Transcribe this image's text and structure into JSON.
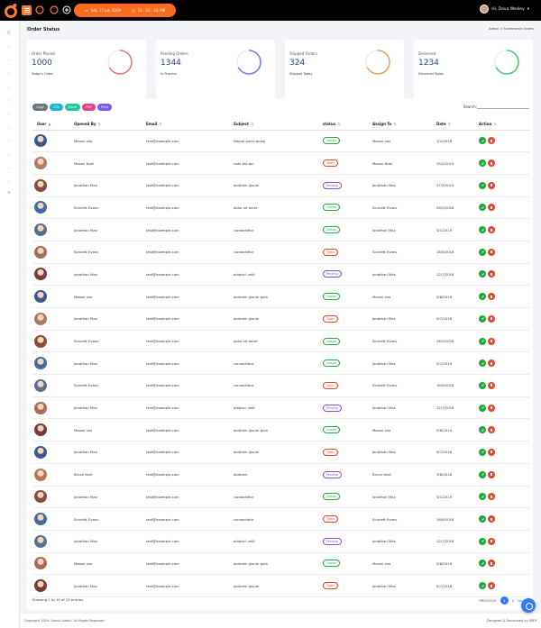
{
  "header": {
    "date": "Sat, 17 jun 2019",
    "time": "10 : 33 : 33 AM",
    "user_name": "Hi, Dova Wesley",
    "brand_color": "#ff6b1f"
  },
  "page": {
    "title": "Order Status",
    "breadcrumb": "Admin > Ecommerce Orders"
  },
  "cards": [
    {
      "label": "Order Placed",
      "value": "1000",
      "sub": "Today's Order",
      "ring_color": "#ef6f6f"
    },
    {
      "label": "Pending Orders",
      "value": "1344",
      "sub": "In Process",
      "ring_color": "#6b7bf0"
    },
    {
      "label": "Shipped Orders",
      "value": "324",
      "sub": "Shipped Today",
      "ring_color": "#f29a55"
    },
    {
      "label": "Delivered",
      "value": "1234",
      "sub": "Delivered Today",
      "ring_color": "#4ec27a"
    }
  ],
  "exports": [
    {
      "label": "Copy",
      "color": "#6c757d"
    },
    {
      "label": "CSV",
      "color": "#17b8d6"
    },
    {
      "label": "Excel",
      "color": "#20c997"
    },
    {
      "label": "PDF",
      "color": "#e83e8c"
    },
    {
      "label": "Print",
      "color": "#7a5af8"
    }
  ],
  "search": {
    "label": "Search:",
    "value": ""
  },
  "table": {
    "headers": [
      "User",
      "Opened By",
      "Email",
      "Subject",
      "status",
      "Assign To",
      "Date",
      "Action"
    ],
    "rows": [
      {
        "opened_by": "Mason vox",
        "email": "test@example.com",
        "subject": "Neque porro quisq",
        "status": "Closed",
        "assign_to": "Mason vox",
        "date": "1/1/2018"
      },
      {
        "opened_by": "Mason Noel",
        "email": "test@example.com",
        "subject": "uam est qui",
        "status": "Open",
        "assign_to": "Mason Noel",
        "date": "15/2/2019"
      },
      {
        "opened_by": "Jonathan Max",
        "email": "test@example.com",
        "subject": "dolorem ipsum",
        "status": "Pending",
        "assign_to": "Jonathan Max",
        "date": "27/3/2019"
      },
      {
        "opened_by": "Scarlett Evans",
        "email": "test@example.com",
        "subject": "dolor sit amet",
        "status": "Closed",
        "assign_to": "Scarlett Evans",
        "date": "26/3/2018"
      },
      {
        "opened_by": "Jonathan Max",
        "email": "test@example.com",
        "subject": "consectetur",
        "status": "Closed",
        "assign_to": "Jonathan Max",
        "date": "5/1/2019"
      },
      {
        "opened_by": "Scarlett Evans",
        "email": "test@example.com",
        "subject": "consectetur",
        "status": "Open",
        "assign_to": "Scarlett Evans",
        "date": "16/9/2018"
      },
      {
        "opened_by": "Jonathan Max",
        "email": "test@example.com",
        "subject": "adipisci velit",
        "status": "Pending",
        "assign_to": "Jonathan Max",
        "date": "12/7/2018"
      },
      {
        "opened_by": "Mason vox",
        "email": "test@example.com",
        "subject": "dolorem ipsum quia",
        "status": "Closed",
        "assign_to": "Mason vox",
        "date": "5/8/2019"
      },
      {
        "opened_by": "Jonathan Max",
        "email": "test@example.com",
        "subject": "dolorem ipsum",
        "status": "Open",
        "assign_to": "Jonathan Max",
        "date": "9/7/2018"
      },
      {
        "opened_by": "Scarlett Evans",
        "email": "test@example.com",
        "subject": "dolor sit amet",
        "status": "Closed",
        "assign_to": "Scarlett Evans",
        "date": "26/3/2018"
      },
      {
        "opened_by": "Jonathan Max",
        "email": "test@example.com",
        "subject": "consectetur",
        "status": "Closed",
        "assign_to": "Jonathan Max",
        "date": "5/1/2019"
      },
      {
        "opened_by": "Scarlett Evans",
        "email": "test@example.com",
        "subject": "consectetur",
        "status": "Open",
        "assign_to": "Scarlett Evans",
        "date": "16/9/2018"
      },
      {
        "opened_by": "Jonathan Max",
        "email": "test@example.com",
        "subject": "adipisci velit",
        "status": "Pending",
        "assign_to": "Jonathan Max",
        "date": "12/7/2018"
      },
      {
        "opened_by": "Mason vox",
        "email": "test@example.com",
        "subject": "dolorem ipsum quia",
        "status": "Closed",
        "assign_to": "Mason vox",
        "date": "5/8/2019"
      },
      {
        "opened_by": "Jonathan Max",
        "email": "test@example.com",
        "subject": "dolorem ipsum",
        "status": "Open",
        "assign_to": "Jonathan Max",
        "date": "9/7/2018"
      },
      {
        "opened_by": "Bruce Kent",
        "email": "test@example.com",
        "subject": "dolorem",
        "status": "Pending",
        "assign_to": "Bruce Kent",
        "date": "3/8/2018"
      },
      {
        "opened_by": "Jonathan Max",
        "email": "test@example.com",
        "subject": "consectetur",
        "status": "Closed",
        "assign_to": "Jonathan Max",
        "date": "5/1/2019"
      },
      {
        "opened_by": "Scarlett Evans",
        "email": "test@example.com",
        "subject": "consectetur",
        "status": "Open",
        "assign_to": "Scarlett Evans",
        "date": "16/9/2018"
      },
      {
        "opened_by": "Jonathan Max",
        "email": "test@example.com",
        "subject": "adipisci velit",
        "status": "Pending",
        "assign_to": "Jonathan Max",
        "date": "12/7/2018"
      },
      {
        "opened_by": "Mason vox",
        "email": "test@example.com",
        "subject": "dolorem ipsum quia",
        "status": "Closed",
        "assign_to": "Mason vox",
        "date": "5/8/2019"
      },
      {
        "opened_by": "Jonathan Max",
        "email": "test@example.com",
        "subject": "dolorem ipsum",
        "status": "Open",
        "assign_to": "Jonathan Max",
        "date": "9/7/2018"
      }
    ]
  },
  "status_colors": {
    "Closed": "#27a844",
    "Open": "#e8452c",
    "Pending": "#8a4fd6"
  },
  "table_footer": {
    "info": "Showing 1 to 10 of 12 entries",
    "prev": "PREVIOUS",
    "pages": [
      "1",
      "2"
    ],
    "next": "Next"
  },
  "footer": {
    "copyright": "Copyright 2019. Almus Admin. All Rights Reserved",
    "credit": "Designed & Developed by SRDF"
  }
}
